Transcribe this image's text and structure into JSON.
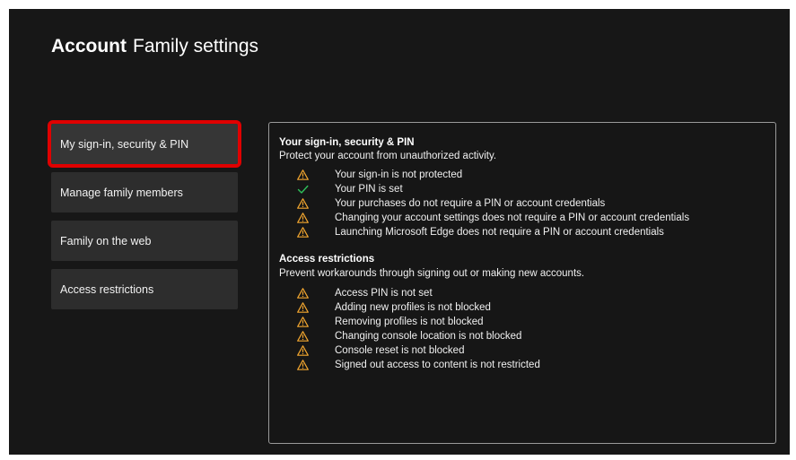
{
  "header": {
    "bold": "Account",
    "title": "Family settings"
  },
  "colors": {
    "warning": "#f2a62f",
    "ok": "#2fbf5a",
    "highlight": "#e00000"
  },
  "menu": [
    {
      "label": "My sign-in, security & PIN",
      "selected": true
    },
    {
      "label": "Manage family members"
    },
    {
      "label": "Family on the web"
    },
    {
      "label": "Access restrictions"
    }
  ],
  "panel": {
    "sections": [
      {
        "title": "Your sign-in, security & PIN",
        "subtitle": "Protect your account from unauthorized activity.",
        "items": [
          {
            "icon": "warning-icon",
            "text": "Your sign-in is not protected"
          },
          {
            "icon": "check-icon",
            "text": "Your PIN is set"
          },
          {
            "icon": "warning-icon",
            "text": "Your purchases do not require a PIN or account credentials"
          },
          {
            "icon": "warning-icon",
            "text": "Changing your account settings does not require a PIN or account credentials"
          },
          {
            "icon": "warning-icon",
            "text": "Launching Microsoft Edge does not require a PIN or account credentials"
          }
        ]
      },
      {
        "title": "Access restrictions",
        "subtitle": "Prevent workarounds through signing out or making new accounts.",
        "items": [
          {
            "icon": "warning-icon",
            "text": "Access PIN is not set"
          },
          {
            "icon": "warning-icon",
            "text": "Adding new profiles is not blocked"
          },
          {
            "icon": "warning-icon",
            "text": "Removing profiles is not blocked"
          },
          {
            "icon": "warning-icon",
            "text": "Changing console location is not blocked"
          },
          {
            "icon": "warning-icon",
            "text": "Console reset is not blocked"
          },
          {
            "icon": "warning-icon",
            "text": "Signed out access to content is not restricted"
          }
        ]
      }
    ]
  }
}
